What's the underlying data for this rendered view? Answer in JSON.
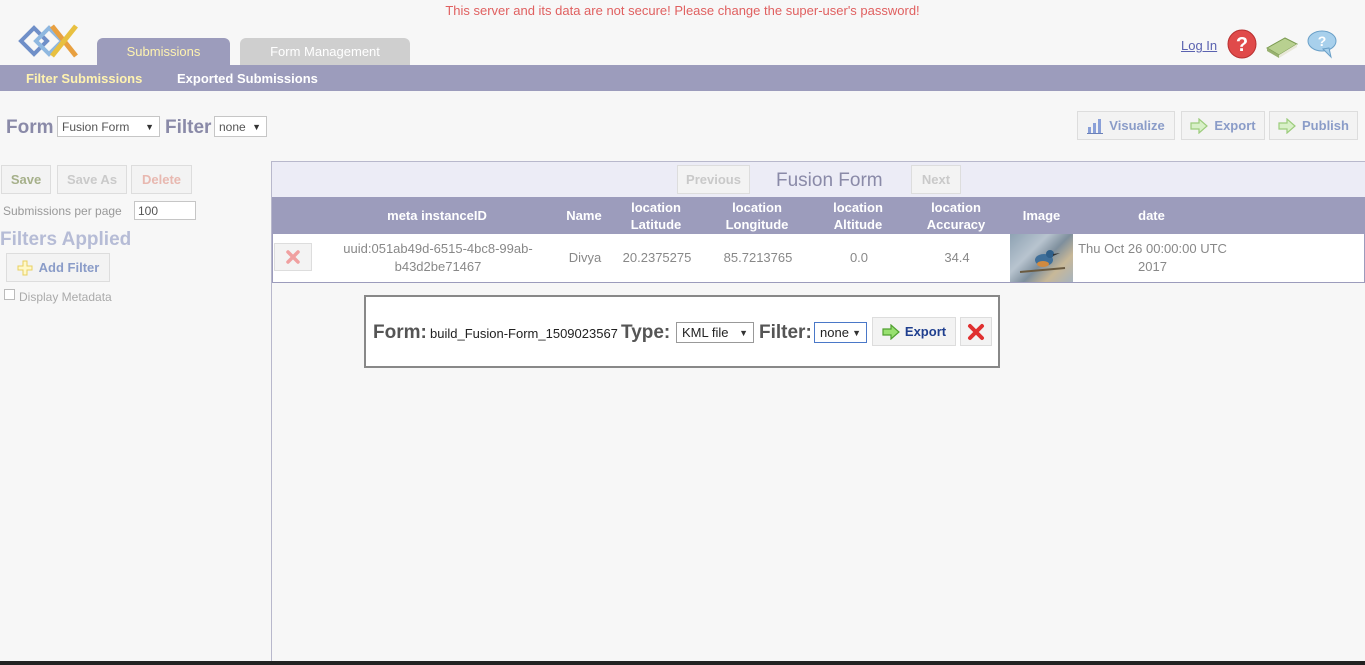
{
  "warning": "This server and its data are not secure! Please change the super-user's password!",
  "logo": {
    "icon": "odk-logo-icon"
  },
  "tabs": [
    {
      "label": "Submissions",
      "active": true
    },
    {
      "label": "Form Management",
      "active": false
    }
  ],
  "header": {
    "login": "Log In",
    "icons": [
      "help-icon",
      "book-icon",
      "feedback-icon"
    ]
  },
  "subnav": {
    "items": [
      {
        "label": "Filter Submissions",
        "active": true
      },
      {
        "label": "Exported Submissions",
        "active": false
      }
    ]
  },
  "toolbar": {
    "form_label": "Form",
    "form_value": "Fusion Form",
    "filter_label": "Filter",
    "filter_value": "none",
    "visualize": "Visualize",
    "export": "Export",
    "publish": "Publish"
  },
  "sidebar": {
    "save": "Save",
    "save_as": "Save As",
    "delete": "Delete",
    "per_page_label": "Submissions per page",
    "per_page_value": "100",
    "filters_applied": "Filters Applied",
    "add_filter": "Add Filter",
    "display_metadata": "Display Metadata"
  },
  "pager": {
    "previous": "Previous",
    "title": "Fusion Form",
    "next": "Next"
  },
  "table": {
    "headers": [
      "meta instanceID",
      "Name",
      "location\nLatitude",
      "location\nLongitude",
      "location\nAltitude",
      "location\nAccuracy",
      "Image",
      "date"
    ],
    "rows": [
      {
        "instance_id": "uuid:051ab49d-6515-4bc8-99ab-b43d2be71467",
        "name": "Divya",
        "latitude": "20.2375275",
        "longitude": "85.7213765",
        "altitude": "0.0",
        "accuracy": "34.4",
        "image": "bird-photo-thumbnail",
        "date": "Thu Oct 26 00:00:00 UTC 2017"
      }
    ]
  },
  "export_dialog": {
    "form_label": "Form:",
    "form_value": "build_Fusion-Form_1509023567",
    "type_label": "Type:",
    "type_value": "KML file",
    "filter_label": "Filter:",
    "filter_value": "none",
    "export_button": "Export"
  },
  "colors": {
    "header_bar": "#9c9cbc",
    "warning": "#e06060",
    "active_tab_text": "#fff3b0",
    "link": "#5a62b0"
  }
}
